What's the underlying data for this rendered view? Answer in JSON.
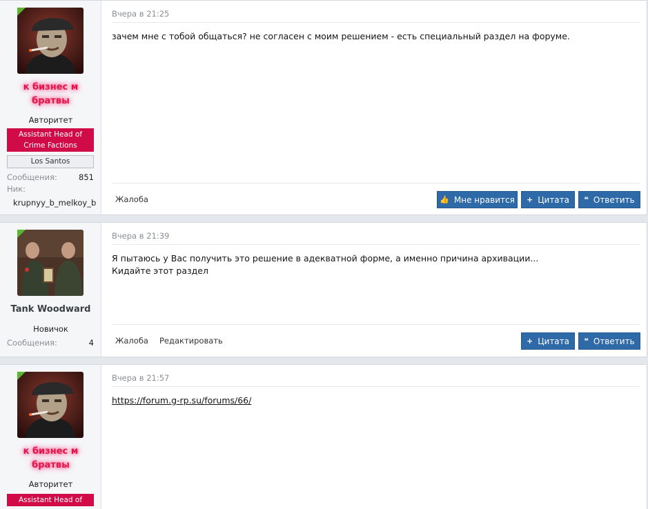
{
  "posts": [
    {
      "user": {
        "name_line1": "к бизнес м",
        "name_line2": "братвы",
        "title": "Авторитет",
        "banner": "Assistant Head of Crime Factions",
        "server": "Los Santos",
        "messages_label": "Сообщения:",
        "messages_value": "851",
        "nick_label": "Ник:",
        "nick_value": "krupnyy_b_melkoy_b"
      },
      "time": "Вчера в 21:25",
      "text_lines": [
        "зачем мне с тобой общаться? не согласен с моим решением - есть специальный раздел на форуме."
      ],
      "footer_links": [
        "Жалоба"
      ],
      "buttons": {
        "like": "Мне нравится",
        "quote": "Цитата",
        "reply": "Ответить"
      }
    },
    {
      "user": {
        "name": "Tank Woodward",
        "title": "Новичок",
        "messages_label": "Сообщения:",
        "messages_value": "4"
      },
      "time": "Вчера в 21:39",
      "text_lines": [
        "Я пытаюсь у Вас получить это решение в адекватной форме, а именно причина архивации...",
        "Кидайте этот раздел"
      ],
      "footer_links": [
        "Жалоба",
        "Редактировать"
      ],
      "buttons": {
        "quote": "Цитата",
        "reply": "Ответить"
      }
    },
    {
      "user": {
        "name_line1": "к бизнес м",
        "name_line2": "братвы",
        "title": "Авторитет",
        "banner_partial": "Assistant Head of"
      },
      "time": "Вчера в 21:57",
      "link": "https://forum.g-rp.su/forums/66/"
    }
  ],
  "icons": {
    "like": "thumbs-up-icon",
    "quote": "plus-icon",
    "reply": "quote-marks-icon",
    "online": "online-indicator"
  },
  "colors": {
    "button": "#2f6aa8",
    "banner": "#d10a48",
    "username_glow": "#e0164b",
    "online": "#5cb531"
  }
}
